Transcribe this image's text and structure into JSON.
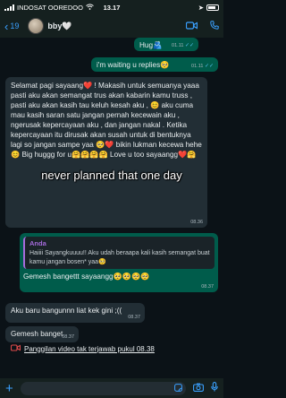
{
  "status_bar": {
    "carrier": "INDOSAT OOREDOO",
    "time": "13.17",
    "battery_icon": "battery-icon",
    "signal_icon": "signal-icon",
    "wifi_icon": "wifi-icon"
  },
  "header": {
    "back_count": "19",
    "contact_name": "bby🤍",
    "video_icon": "video-call-icon",
    "phone_icon": "phone-call-icon"
  },
  "messages": [
    {
      "id": "m1",
      "dir": "out",
      "text": "Hug🫂",
      "time": "01.11"
    },
    {
      "id": "m2",
      "dir": "out",
      "text": "i'm waiting u replies🥺",
      "time": "01.11"
    },
    {
      "id": "m3",
      "dir": "in",
      "text": "Selamat pagi sayaang❤️ ! Makasih untuk semuanya yaaa pasti aku akan semangat trus akan kabarin kamu truss , pasti aku akan kasih tau keluh kesah aku , 😊 aku cuma mau kasih saran satu jangan pernah kecewain aku , ngerusak kepercayaan aku , dan jangan nakal . Ketika kepercayaan itu dirusak akan susah untuk di bentuknya lagi so jangan sampe yaa 🥺❤️ bikin lukman kecewa hehe😊 Big huggg for u🤗🤗🤗🤗 Love u too sayaangg❤️🤗",
      "time": "08.36"
    },
    {
      "id": "m4",
      "dir": "out",
      "quote_name": "Anda",
      "quote_text": "Haiiii Sayangkuuuu!! Aku udah beraapa kali kasih semangat buat kamu jangan bosen* yaa🥺",
      "text": "Gemesh bangettt sayaangg🥺🥺🥺🥺",
      "time": "08.37"
    },
    {
      "id": "m5",
      "dir": "in",
      "text": "Aku baru bangunnn liat kek gini ;((",
      "time": "08.37"
    },
    {
      "id": "m6",
      "dir": "in",
      "text": "Gemesh banget",
      "time": "08.37"
    }
  ],
  "overlay_caption": "never planned that one day",
  "missed_call": {
    "icon": "missed-video-call-icon",
    "text": "Panggilan video tak terjawab pukul 08.38"
  },
  "composer": {
    "plus_icon": "plus-icon",
    "sticker_icon": "sticker-icon",
    "camera_icon": "camera-icon",
    "mic_icon": "mic-icon"
  }
}
